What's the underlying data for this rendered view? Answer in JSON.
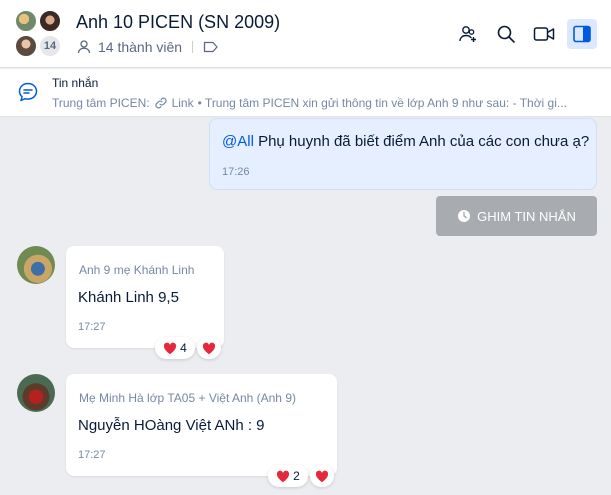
{
  "header": {
    "title": "Anh 10 PICEN (SN 2009)",
    "member_count_badge": "14",
    "members_label": "14 thành viên",
    "icons": [
      "add-member-icon",
      "search-icon",
      "video-call-icon",
      "sidebar-toggle-icon"
    ]
  },
  "pinned": {
    "title": "Tin nhắn",
    "source": "Trung tâm PICEN:",
    "link_label": "Link",
    "preview": "• Trung tâm PICEN xin gửi thông tin về lớp Anh 9 như sau: - Thời gi..."
  },
  "messages": {
    "mine": {
      "mention": "@All",
      "text": " Phụ huynh đã biết điểm Anh của các con chưa ạ?",
      "time": "17:26"
    },
    "pin_button_label": "GHIM TIN NHẮN",
    "msg1": {
      "sender": "Anh 9 mẹ Khánh Linh",
      "text": "Khánh Linh 9,5",
      "time": "17:27",
      "reaction_count": "4"
    },
    "msg2": {
      "sender": "Mẹ Minh Hà lớp TA05 + Việt Anh (Anh 9)",
      "text": "Nguyễn HOàng Việt ANh : 9",
      "time": "17:27",
      "reaction_count": "2"
    }
  },
  "colors": {
    "accent": "#005ae0",
    "heart": "#e5283c"
  }
}
